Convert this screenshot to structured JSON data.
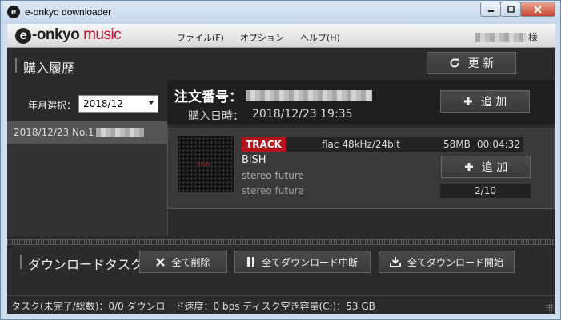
{
  "window": {
    "title": "e-onkyo downloader",
    "icon_letter": "e"
  },
  "logo": {
    "e": "e",
    "dash_onkyo": "-onkyo",
    "music": "music"
  },
  "menu": {
    "items": [
      "ファイル(F)",
      "オプション",
      "ヘルプ(H)"
    ]
  },
  "user": {
    "suffix": "様"
  },
  "history": {
    "title": "購入履歴",
    "year_label": "年月選択：",
    "year_value": "2018/12",
    "items": [
      {
        "label": "2018/12/23 No.1"
      }
    ]
  },
  "refresh": {
    "label": "更 新"
  },
  "order": {
    "number_label": "注文番号：",
    "date_label": "購入日時：",
    "date_value": "2018/12/23 19:35",
    "add_label": "追 加"
  },
  "track": {
    "badge": "TRACK",
    "format": "flac 48kHz/24bit",
    "size": "58MB",
    "duration": "00:04:32",
    "artist": "BiSH",
    "album": "stereo future",
    "title": "stereo future",
    "add_label": "追 加",
    "count": "2/10",
    "cover_text": "BiSH"
  },
  "tasks": {
    "title": "ダウンロードタスク",
    "delete_all": "全て削除",
    "pause_all": "全てダウンロード中断",
    "start_all": "全てダウンロード開始"
  },
  "status": {
    "text": "タスク(未完了/総数)：0/0  ダウンロード速度：0 bps  ディスク空き容量(C:)：53 GB"
  },
  "icons": {
    "refresh": "refresh-icon",
    "plus": "plus-icon",
    "close": "x-icon",
    "pause": "pause-icon",
    "download": "download-icon"
  },
  "colors": {
    "track_badge": "#b5121b",
    "logo_music": "#c8102e",
    "panel_bg": "#2b2b2b"
  }
}
